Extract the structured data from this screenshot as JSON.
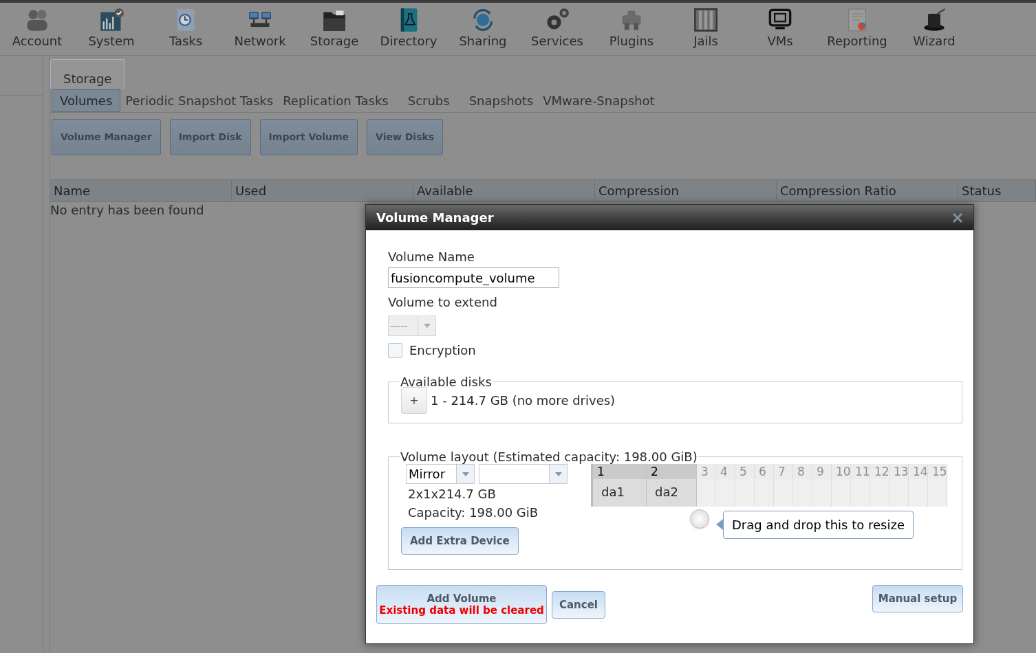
{
  "nav": [
    {
      "label": "Account"
    },
    {
      "label": "System"
    },
    {
      "label": "Tasks"
    },
    {
      "label": "Network"
    },
    {
      "label": "Storage"
    },
    {
      "label": "Directory"
    },
    {
      "label": "Sharing"
    },
    {
      "label": "Services"
    },
    {
      "label": "Plugins"
    },
    {
      "label": "Jails"
    },
    {
      "label": "VMs"
    },
    {
      "label": "Reporting"
    },
    {
      "label": "Wizard"
    }
  ],
  "page_tab": {
    "label": "Storage"
  },
  "subtabs": [
    {
      "label": "Volumes",
      "selected": true
    },
    {
      "label": "Periodic Snapshot Tasks",
      "selected": false
    },
    {
      "label": "Replication Tasks",
      "selected": false
    },
    {
      "label": "Scrubs",
      "selected": false
    },
    {
      "label": "Snapshots",
      "selected": false
    },
    {
      "label": "VMware-Snapshot",
      "selected": false
    }
  ],
  "actions": [
    "Volume Manager",
    "Import Disk",
    "Import Volume",
    "View Disks"
  ],
  "table": {
    "columns": [
      "Name",
      "Used",
      "Available",
      "Compression",
      "Compression Ratio",
      "Status"
    ],
    "empty_message": "No entry has been found"
  },
  "dialog": {
    "title": "Volume Manager",
    "volume_name": {
      "label": "Volume Name",
      "value": "fusioncompute_volume"
    },
    "volume_to_extend": {
      "label": "Volume to extend",
      "value": "-----",
      "disabled": true
    },
    "encryption": {
      "label": "Encryption",
      "checked": false
    },
    "available_disks": {
      "legend": "Available disks",
      "add_button": "+",
      "text": "1 - 214.7 GB (no more drives)"
    },
    "volume_layout": {
      "legend": "Volume layout (Estimated capacity: 198.00 GiB)",
      "layout_type": "Mirror",
      "summary": "2x1x214.7 GB",
      "capacity": "Capacity: 198.00 GiB",
      "add_extra_button": "Add Extra Device",
      "columns": [
        {
          "label": "1",
          "disk": "da1",
          "used": true
        },
        {
          "label": "2",
          "disk": "da2",
          "used": true
        },
        {
          "label": "3",
          "used": false
        },
        {
          "label": "4",
          "used": false
        },
        {
          "label": "5",
          "used": false
        },
        {
          "label": "6",
          "used": false
        },
        {
          "label": "7",
          "used": false
        },
        {
          "label": "8",
          "used": false
        },
        {
          "label": "9",
          "used": false
        },
        {
          "label": "10",
          "used": false
        },
        {
          "label": "11",
          "used": false
        },
        {
          "label": "12",
          "used": false
        },
        {
          "label": "13",
          "used": false
        },
        {
          "label": "14",
          "used": false
        },
        {
          "label": "15",
          "used": false
        }
      ],
      "tooltip": "Drag and drop this to resize"
    },
    "add_volume": {
      "label": "Add Volume",
      "warning": "Existing data will be cleared"
    },
    "cancel": "Cancel",
    "manual_setup": "Manual setup"
  }
}
